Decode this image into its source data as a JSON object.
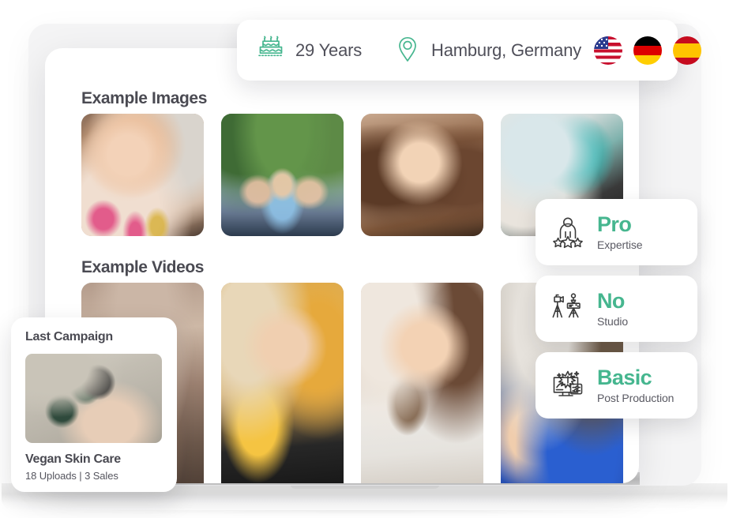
{
  "top_bar": {
    "age_icon": "birthday-cake-icon",
    "age": "29 Years",
    "location_icon": "map-pin-icon",
    "location": "Hamburg, Germany",
    "flags": [
      {
        "name": "flag-us",
        "label": "United States"
      },
      {
        "name": "flag-de",
        "label": "Germany"
      },
      {
        "name": "flag-es",
        "label": "Spain"
      }
    ]
  },
  "profile": {
    "images_section_title": "Example Images",
    "videos_section_title": "Example Videos",
    "example_images": [
      {
        "alt": "Woman in floral blouse selfie"
      },
      {
        "alt": "Three women posing outdoors under trees"
      },
      {
        "alt": "Woman with long brown hair close-up"
      },
      {
        "alt": "Woman working at marbled art wall"
      }
    ],
    "example_videos": [
      {
        "alt": "Bathroom tile background clip"
      },
      {
        "alt": "Woman holding yellow tea box"
      },
      {
        "alt": "Woman holding chocolate dessert"
      },
      {
        "alt": "Person in blue jacket giving thumbs up"
      }
    ]
  },
  "badges": [
    {
      "icon": "person-stars-icon",
      "title": "Pro",
      "subtitle": "Expertise"
    },
    {
      "icon": "studio-tripod-icon",
      "title": "No",
      "subtitle": "Studio"
    },
    {
      "icon": "monitor-edit-icon",
      "title": "Basic",
      "subtitle": "Post Production"
    }
  ],
  "campaign": {
    "heading": "Last Campaign",
    "thumbnail_alt": "Hand reaching for skin care jar",
    "name": "Vegan Skin Care",
    "stats": "18 Uploads | 3 Sales"
  },
  "colors": {
    "accent_green": "#46b68f",
    "text_dark": "#4a4a52",
    "text_muted": "#5a5a63",
    "panel_white": "#ffffff",
    "page_background": "#ffffff"
  }
}
